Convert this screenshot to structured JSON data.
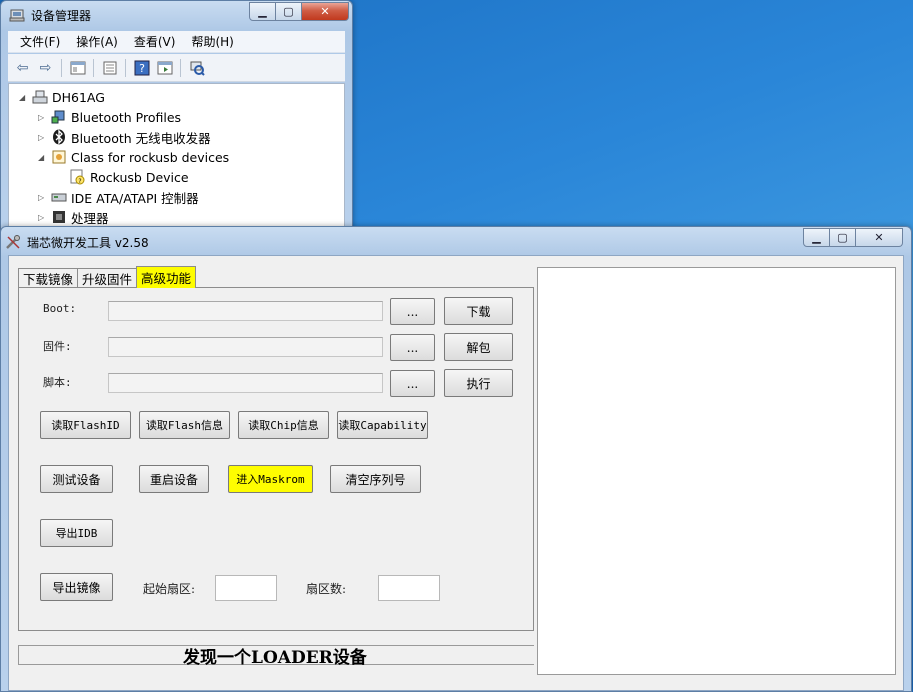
{
  "device_manager": {
    "title": "设备管理器",
    "menu": [
      "文件(F)",
      "操作(A)",
      "查看(V)",
      "帮助(H)"
    ],
    "controls": {
      "minimize": "▁",
      "maximize": "▢",
      "close": "✕"
    },
    "tree": [
      {
        "label": "DH61AG",
        "icon": "computer-icon",
        "expander": "◢",
        "level": 0
      },
      {
        "label": "Bluetooth Profiles",
        "icon": "bluetooth-profiles-icon",
        "expander": "▷",
        "level": 1
      },
      {
        "label": "Bluetooth 无线电收发器",
        "icon": "bluetooth-icon",
        "expander": "▷",
        "level": 1
      },
      {
        "label": "Class for rockusb devices",
        "icon": "usb-class-icon",
        "expander": "◢",
        "level": 1
      },
      {
        "label": "Rockusb Device",
        "icon": "unknown-device-icon",
        "expander": "",
        "level": 2
      },
      {
        "label": "IDE ATA/ATAPI 控制器",
        "icon": "ide-controller-icon",
        "expander": "▷",
        "level": 1
      },
      {
        "label": "处理器",
        "icon": "processor-icon",
        "expander": "▷",
        "level": 1
      }
    ]
  },
  "tool": {
    "title": "瑞芯微开发工具 v2.58",
    "controls": {
      "minimize": "▁",
      "maximize": "▢",
      "close": "✕"
    },
    "tabs": [
      "下载镜像",
      "升级固件",
      "高级功能"
    ],
    "active_tab": "高级功能",
    "highlight_color": "#fefd00",
    "rows": {
      "boot_label": "Boot:",
      "firmware_label": "固件:",
      "script_label": "脚本:",
      "browse": "...",
      "download": "下载",
      "unpack": "解包",
      "execute": "执行"
    },
    "buttons": {
      "read_flash_id": "读取FlashID",
      "read_flash_info": "读取Flash信息",
      "read_chip_info": "读取Chip信息",
      "read_capability": "读取Capability",
      "test_device": "测试设备",
      "reset_device": "重启设备",
      "enter_maskrom": "进入Maskrom",
      "clear_serial": "清空序列号",
      "export_idb": "导出IDB",
      "export_image": "导出镜像"
    },
    "start_sector_label": "起始扇区:",
    "sector_count_label": "扇区数:",
    "status": "发现一个LOADER设备"
  }
}
